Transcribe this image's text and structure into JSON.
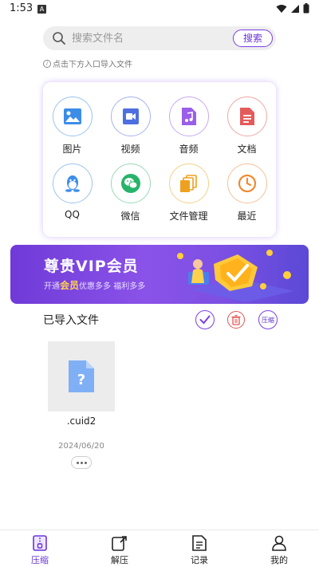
{
  "status_bar": {
    "time": "1:53",
    "notification_letter": "A"
  },
  "search": {
    "placeholder": "搜索文件名",
    "button_label": "搜索"
  },
  "hint": {
    "text": "点击下方入口导入文件",
    "icon_glyph": "i"
  },
  "categories": [
    {
      "label": "图片",
      "icon": "image-icon",
      "color": "#3b8de8"
    },
    {
      "label": "视频",
      "icon": "video-icon",
      "color": "#4f6fe0"
    },
    {
      "label": "音频",
      "icon": "audio-icon",
      "color": "#9a5ee8"
    },
    {
      "label": "文档",
      "icon": "document-icon",
      "color": "#e45b5b"
    },
    {
      "label": "QQ",
      "icon": "qq-icon",
      "color": "#3b8de8"
    },
    {
      "label": "微信",
      "icon": "wechat-icon",
      "color": "#28b36a"
    },
    {
      "label": "文件管理",
      "icon": "folder-icon",
      "color": "#f0a020"
    },
    {
      "label": "最近",
      "icon": "clock-icon",
      "color": "#f08a30"
    }
  ],
  "banner": {
    "title": "尊贵VIP会员",
    "sub_prefix": "开通",
    "sub_highlight": "会员",
    "sub_suffix": "优惠多多 福利多多"
  },
  "imported": {
    "title": "已导入文件",
    "compress_label": "压缩"
  },
  "files": [
    {
      "name": ".cuid2",
      "date": "2024/06/20",
      "icon_glyph": "?"
    }
  ],
  "bottom_nav": [
    {
      "label": "压缩",
      "icon": "compress-icon",
      "active": true
    },
    {
      "label": "解压",
      "icon": "extract-icon",
      "active": false
    },
    {
      "label": "记录",
      "icon": "record-icon",
      "active": false
    },
    {
      "label": "我的",
      "icon": "profile-icon",
      "active": false
    }
  ],
  "colors": {
    "accent": "#7b3fe4",
    "danger": "#e25555"
  }
}
